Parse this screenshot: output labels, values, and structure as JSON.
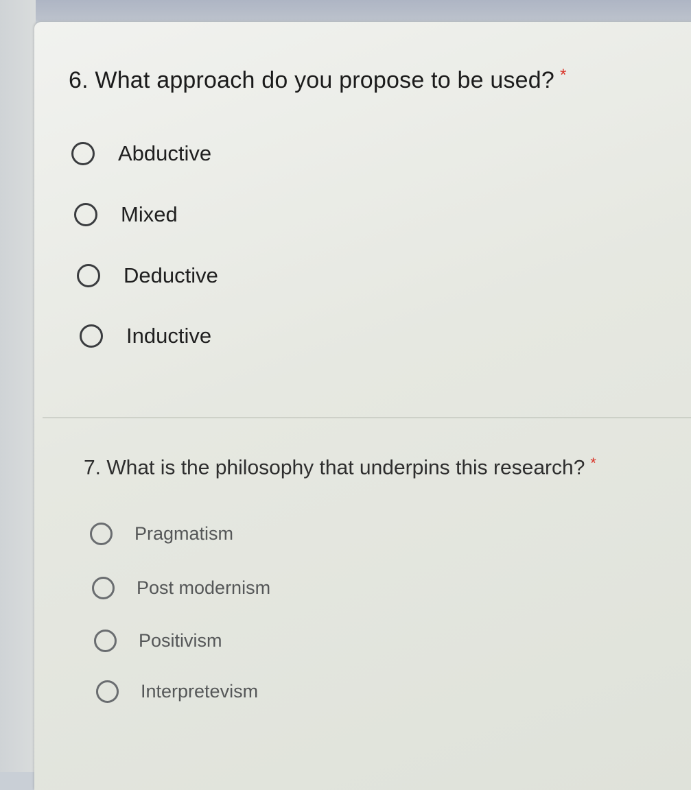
{
  "questions": [
    {
      "title": "6. What approach do you propose to be used?",
      "required_marker": "*",
      "options": [
        "Abductive",
        "Mixed",
        "Deductive",
        "Inductive"
      ]
    },
    {
      "title": "7. What is the philosophy that underpins this research?",
      "required_marker": "*",
      "options": [
        "Pragmatism",
        "Post modernism",
        "Positivism",
        "Interpretevism"
      ]
    }
  ],
  "colors": {
    "required_asterisk": "#d93025",
    "radio_border_q6": "#3a3c3f",
    "radio_border_q7": "#6a6d70",
    "card_background": "#e6e8e1"
  },
  "icons": {
    "radio": "empty-circle-radio-icon"
  }
}
